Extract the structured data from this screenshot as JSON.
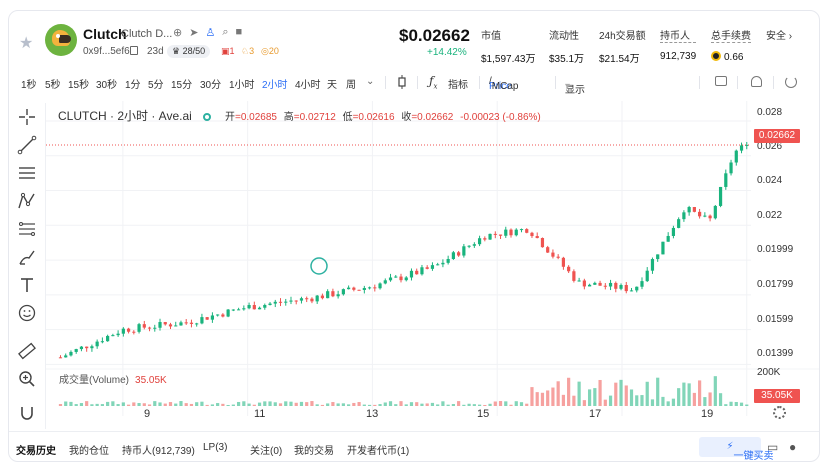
{
  "header": {
    "token_name": "Clutch",
    "token_fullname": "Clutch D...",
    "address": "0x9f...5ef6",
    "age": "23d",
    "holders_badge": "28/50",
    "risk_flag_1": "1",
    "risk_flag_2": "3",
    "risk_flag_3": "20",
    "price": "$0.02662",
    "change": "+14.42%",
    "stats": [
      {
        "label": "市值",
        "value": "$1,597.43万"
      },
      {
        "label": "流动性",
        "value": "$35.1万"
      },
      {
        "label": "24h交易额",
        "value": "$21.54万"
      },
      {
        "label": "持币人",
        "value": "912,739"
      },
      {
        "label": "总手续费",
        "value": "0.66"
      }
    ],
    "safety_label": "安全",
    "colors": {
      "up": "#19b37d",
      "down": "#ef5350",
      "accent": "#2b6ef5"
    }
  },
  "toolbar": {
    "intervals": [
      "1秒",
      "5秒",
      "15秒",
      "30秒",
      "1分",
      "5分",
      "15分",
      "30分",
      "1小时",
      "2小时",
      "4小时",
      "天",
      "周"
    ],
    "active_interval": "2小时",
    "indicators_label": "指标",
    "price_label": "Price",
    "mcap_label": "MCap",
    "display_label": "显示"
  },
  "chart_data": {
    "type": "candlestick",
    "title": "CLUTCH · 2小时 · Ave.ai",
    "ohlc_labels": {
      "open": "开",
      "high": "高",
      "low": "低",
      "close": "收"
    },
    "ohlc_values": {
      "open": "=0.02685",
      "high": "=0.02712",
      "low": "=0.02616",
      "close": "=0.02662",
      "change": "-0.00023 (-0.86%)"
    },
    "y_ticks": [
      "0.028",
      "0.026",
      "0.024",
      "0.022",
      "0.01999",
      "0.01799",
      "0.01599",
      "0.01399"
    ],
    "x_ticks": [
      "9",
      "11",
      "13",
      "15",
      "17",
      "19"
    ],
    "last_price": "0.02662",
    "volume_label": "成交量(Volume)",
    "volume_value": "35.05K",
    "volume_axis_tick": "200K",
    "grid": true,
    "close_path_approx": [
      {
        "day": 8.0,
        "price": 0.0144
      },
      {
        "day": 9.0,
        "price": 0.016
      },
      {
        "day": 10.0,
        "price": 0.0164
      },
      {
        "day": 11.0,
        "price": 0.0173
      },
      {
        "day": 12.0,
        "price": 0.0178
      },
      {
        "day": 13.0,
        "price": 0.0185
      },
      {
        "day": 14.0,
        "price": 0.0196
      },
      {
        "day": 14.8,
        "price": 0.0214
      },
      {
        "day": 15.5,
        "price": 0.0218
      },
      {
        "day": 16.3,
        "price": 0.0187
      },
      {
        "day": 17.2,
        "price": 0.0183
      },
      {
        "day": 18.0,
        "price": 0.023
      },
      {
        "day": 18.4,
        "price": 0.0222
      },
      {
        "day": 18.8,
        "price": 0.0262
      },
      {
        "day": 19.0,
        "price": 0.02662
      }
    ]
  },
  "bottom_tabs": {
    "items": [
      "交易历史",
      "我的仓位",
      "持币人(912,739)",
      "LP(3)",
      "关注(0)",
      "我的交易",
      "开发者代币(1)"
    ],
    "active": "交易历史",
    "buy_label": "一键买卖"
  }
}
